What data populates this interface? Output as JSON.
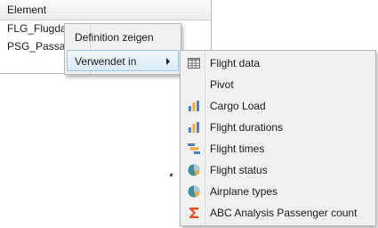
{
  "table": {
    "column_header": "Element",
    "rows": [
      {
        "label": "FLG_Flugdaten"
      },
      {
        "label": "PSG_Passagiere"
      }
    ]
  },
  "context_menu": {
    "items": [
      {
        "label": "Definition zeigen"
      },
      {
        "label": "Verwendet in"
      }
    ]
  },
  "submenu": {
    "items": [
      {
        "label": "Flight data",
        "icon": "table-icon"
      },
      {
        "label": "Pivot",
        "icon": ""
      },
      {
        "label": "Cargo Load",
        "icon": "bar-chart-icon"
      },
      {
        "label": "Flight durations",
        "icon": "bar-chart-icon"
      },
      {
        "label": "Flight times",
        "icon": "gantt-chart-icon"
      },
      {
        "label": "Flight status",
        "icon": "pie-chart-icon"
      },
      {
        "label": "Airplane types",
        "icon": "pie-chart-icon"
      },
      {
        "label": "ABC Analysis Passenger count",
        "icon": "sigma-icon"
      }
    ]
  },
  "colors": {
    "hover_background": "#dbeaf8",
    "hover_border": "#9cc2e5",
    "sigma": "#e8532a",
    "bar_blue": "#4f81bd",
    "bar_orange": "#f2a93b",
    "pie_teal": "#3f8fa3"
  }
}
